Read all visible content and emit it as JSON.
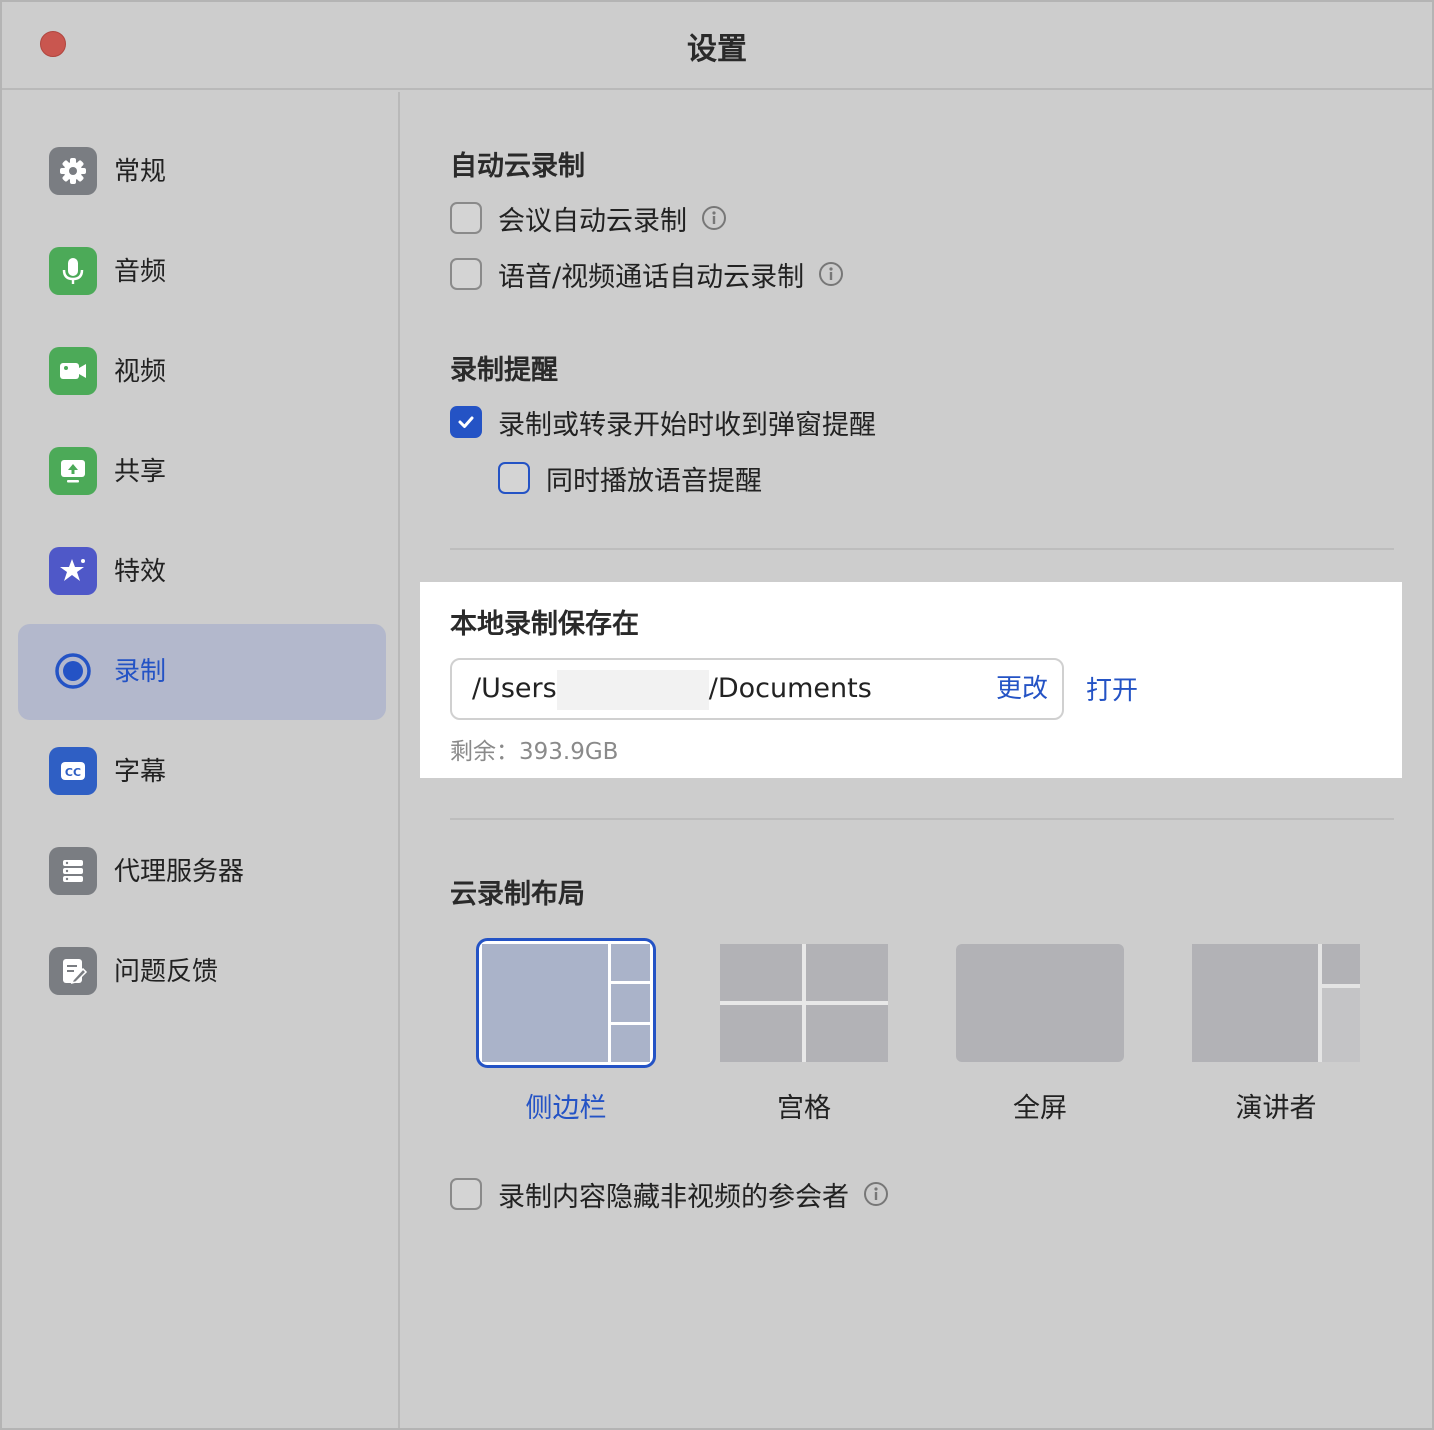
{
  "window": {
    "title": "设置"
  },
  "sidebar": {
    "items": [
      {
        "label": "常规",
        "icon": "gear-icon",
        "color": "#7a7d82",
        "active": false
      },
      {
        "label": "音频",
        "icon": "microphone-icon",
        "color": "#4caa58",
        "active": false
      },
      {
        "label": "视频",
        "icon": "video-camera-icon",
        "color": "#4caa58",
        "active": false
      },
      {
        "label": "共享",
        "icon": "share-screen-icon",
        "color": "#4caa58",
        "active": false
      },
      {
        "label": "特效",
        "icon": "effects-star-icon",
        "color": "#4f58c8",
        "active": false
      },
      {
        "label": "录制",
        "icon": "record-icon",
        "color": "#2453c5",
        "active": true
      },
      {
        "label": "字幕",
        "icon": "closed-caption-icon",
        "color": "#2f5fc4",
        "active": false
      },
      {
        "label": "代理服务器",
        "icon": "server-icon",
        "color": "#7a7d82",
        "active": false
      },
      {
        "label": "问题反馈",
        "icon": "feedback-icon",
        "color": "#7a7d82",
        "active": false
      }
    ]
  },
  "auto_cloud": {
    "title": "自动云录制",
    "options": [
      {
        "label": "会议自动云录制",
        "checked": false
      },
      {
        "label": "语音/视频通话自动云录制",
        "checked": false
      }
    ]
  },
  "reminder": {
    "title": "录制提醒",
    "options": [
      {
        "label": "录制或转录开始时收到弹窗提醒",
        "checked": true
      },
      {
        "label": "同时播放语音提醒",
        "checked": false
      }
    ]
  },
  "local_save": {
    "title": "本地录制保存在",
    "path_prefix": "/Users",
    "path_suffix": "/Documents",
    "change_label": "更改",
    "open_label": "打开",
    "remaining": "剩余：393.9GB"
  },
  "cloud_layout": {
    "title": "云录制布局",
    "options": [
      {
        "label": "侧边栏",
        "selected": true
      },
      {
        "label": "宫格",
        "selected": false
      },
      {
        "label": "全屏",
        "selected": false
      },
      {
        "label": "演讲者",
        "selected": false
      }
    ]
  },
  "hide_non_video": {
    "label": "录制内容隐藏非视频的参会者",
    "checked": false
  },
  "colors": {
    "accent": "#2453c5",
    "close": "#c9564f"
  }
}
